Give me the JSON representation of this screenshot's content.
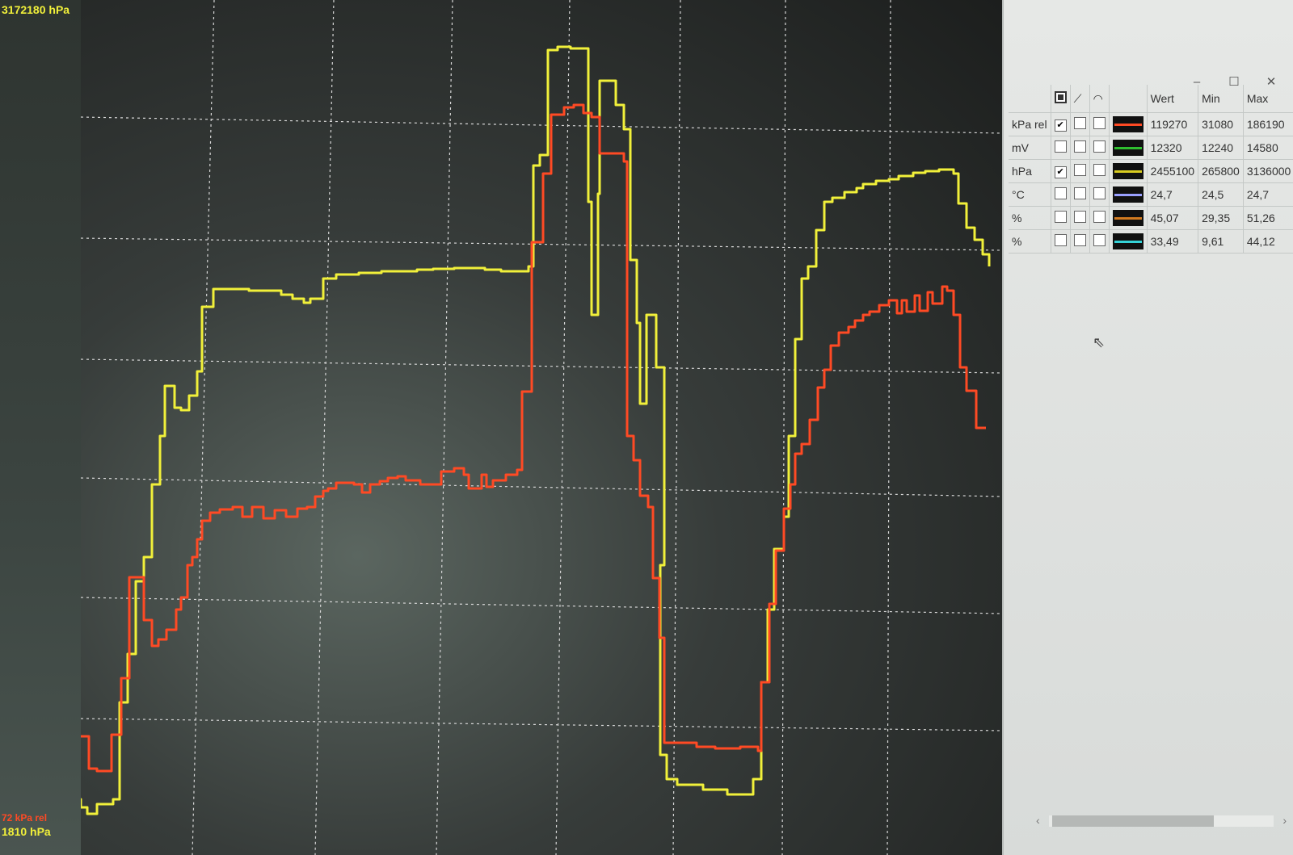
{
  "axis": {
    "top_label": "3172180 hPa",
    "bottom_label_1": "72 kPa rel",
    "bottom_label_2": "1810 hPa"
  },
  "colors": {
    "red": "#ff4a24",
    "yellow": "#f1f03a",
    "green": "#2fbf2f",
    "olive": "#d8cc20",
    "blue": "#9aa0ff",
    "orange": "#d27a20",
    "cyan": "#35d3d8"
  },
  "table": {
    "headers": [
      "Wert",
      "Min",
      "Max"
    ],
    "header_icons": [
      "stop-icon",
      "trend-icon",
      "gauge-icon"
    ],
    "rows": [
      {
        "unit": "kPa rel",
        "show": true,
        "gauge": false,
        "color": "#ff4a24",
        "wert": "119270",
        "min": "31080",
        "max": "186190"
      },
      {
        "unit": "mV",
        "show": false,
        "gauge": false,
        "color": "#2fbf2f",
        "wert": "12320",
        "min": "12240",
        "max": "14580"
      },
      {
        "unit": "hPa",
        "show": true,
        "gauge": false,
        "color": "#d8cc20",
        "wert": "2455100",
        "min": "265800",
        "max": "3136000"
      },
      {
        "unit": "°C",
        "show": false,
        "gauge": false,
        "color": "#9aa0ff",
        "wert": "24,7",
        "min": "24,5",
        "max": "24,7"
      },
      {
        "unit": "%",
        "show": false,
        "gauge": false,
        "color": "#d27a20",
        "wert": "45,07",
        "min": "29,35",
        "max": "51,26"
      },
      {
        "unit": "%",
        "show": false,
        "gauge": false,
        "color": "#35d3d8",
        "wert": "33,49",
        "min": "9,61",
        "max": "44,12"
      }
    ]
  }
}
